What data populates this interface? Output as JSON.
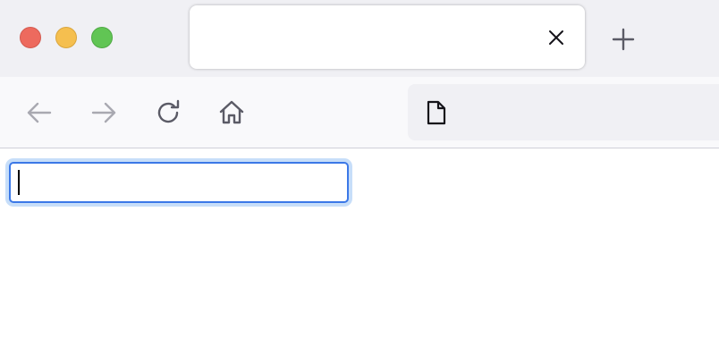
{
  "window": {
    "traffic_lights": {
      "close_color": "#ed6a5e",
      "minimize_color": "#f5bf4f",
      "maximize_color": "#61c554"
    }
  },
  "tab": {
    "title": "",
    "close_icon": "close-icon"
  },
  "new_tab": {
    "icon": "plus-icon"
  },
  "toolbar": {
    "back_icon": "arrow-left-icon",
    "forward_icon": "arrow-right-icon",
    "reload_icon": "reload-icon",
    "home_icon": "home-icon"
  },
  "urlbar": {
    "page_icon": "document-icon",
    "url": ""
  },
  "page": {
    "input": {
      "value": "",
      "placeholder": "",
      "focused": true
    }
  },
  "colors": {
    "focus_border": "#3b78e7",
    "focus_ring": "#c7def9",
    "tabstrip_bg": "#f0f0f4",
    "toolbar_bg": "#f9f9fb"
  }
}
